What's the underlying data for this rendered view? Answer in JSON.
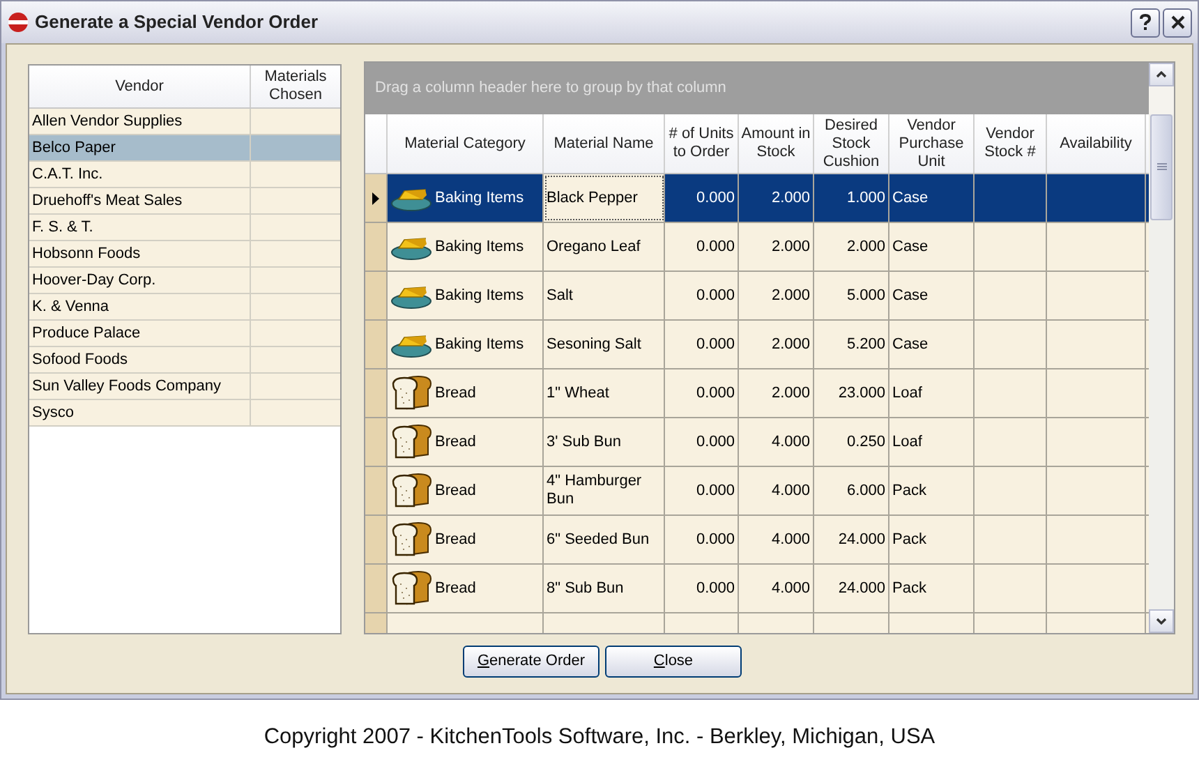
{
  "window": {
    "title": "Generate a Special Vendor Order"
  },
  "vendors": {
    "columns": [
      "Vendor",
      "Materials Chosen"
    ],
    "rows": [
      {
        "name": "Allen Vendor Supplies",
        "selected": false
      },
      {
        "name": "Belco Paper",
        "selected": true
      },
      {
        "name": "C.A.T. Inc.",
        "selected": false
      },
      {
        "name": "Druehoff's Meat Sales",
        "selected": false
      },
      {
        "name": "F. S. & T.",
        "selected": false
      },
      {
        "name": "Hobsonn Foods",
        "selected": false
      },
      {
        "name": "Hoover-Day Corp.",
        "selected": false
      },
      {
        "name": "K. & Venna",
        "selected": false
      },
      {
        "name": "Produce Palace",
        "selected": false
      },
      {
        "name": "Sofood Foods",
        "selected": false
      },
      {
        "name": "Sun Valley Foods Company",
        "selected": false
      },
      {
        "name": "Sysco",
        "selected": false
      }
    ]
  },
  "materials": {
    "group_hint": "Drag a column header here to group by that column",
    "columns": [
      "Material Category",
      "Material Name",
      "# of Units to Order",
      "Amount in Stock",
      "Desired Stock Cushion",
      "Vendor Purchase Unit",
      "Vendor Stock #",
      "Availability"
    ],
    "rows": [
      {
        "kind": "butter",
        "category": "Baking Items",
        "name": "Black Pepper",
        "units": "0.000",
        "amount": "2.000",
        "cushion": "1.000",
        "unit": "Case",
        "selected": true
      },
      {
        "kind": "butter",
        "category": "Baking Items",
        "name": "Oregano Leaf",
        "units": "0.000",
        "amount": "2.000",
        "cushion": "2.000",
        "unit": "Case",
        "selected": false
      },
      {
        "kind": "butter",
        "category": "Baking Items",
        "name": "Salt",
        "units": "0.000",
        "amount": "2.000",
        "cushion": "5.000",
        "unit": "Case",
        "selected": false
      },
      {
        "kind": "butter",
        "category": "Baking Items",
        "name": "Sesoning Salt",
        "units": "0.000",
        "amount": "2.000",
        "cushion": "5.200",
        "unit": "Case",
        "selected": false
      },
      {
        "kind": "bread",
        "category": "Bread",
        "name": "1\" Wheat",
        "units": "0.000",
        "amount": "2.000",
        "cushion": "23.000",
        "unit": "Loaf",
        "selected": false
      },
      {
        "kind": "bread",
        "category": "Bread",
        "name": "3' Sub Bun",
        "units": "0.000",
        "amount": "4.000",
        "cushion": "0.250",
        "unit": "Loaf",
        "selected": false
      },
      {
        "kind": "bread",
        "category": "Bread",
        "name": "4\" Hamburger Bun",
        "units": "0.000",
        "amount": "4.000",
        "cushion": "6.000",
        "unit": "Pack",
        "selected": false
      },
      {
        "kind": "bread",
        "category": "Bread",
        "name": "6\" Seeded Bun",
        "units": "0.000",
        "amount": "4.000",
        "cushion": "24.000",
        "unit": "Pack",
        "selected": false
      },
      {
        "kind": "bread",
        "category": "Bread",
        "name": "8\" Sub Bun",
        "units": "0.000",
        "amount": "4.000",
        "cushion": "24.000",
        "unit": "Pack",
        "selected": false
      }
    ]
  },
  "buttons": [
    {
      "label": "Generate Order",
      "first_letter_underlined": true
    },
    {
      "label": "Close",
      "first_letter_underlined": true
    }
  ],
  "copyright": "Copyright 2007 - KitchenTools Software, Inc. - Berkley, Michigan, USA"
}
